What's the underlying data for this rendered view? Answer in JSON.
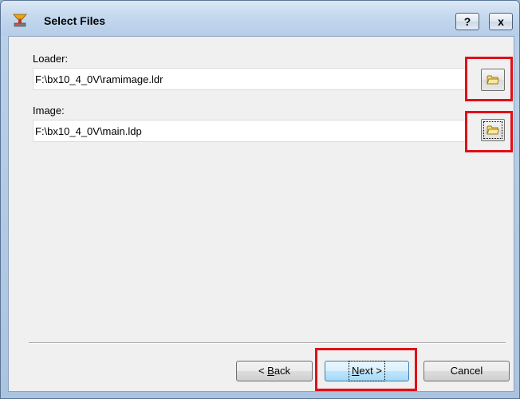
{
  "window": {
    "title": "Select Files",
    "help_label": "?",
    "close_label": "x"
  },
  "form": {
    "loader_label": "Loader:",
    "loader_value": "F:\\bx10_4_0V\\ramimage.ldr",
    "image_label": "Image:",
    "image_value": "F:\\bx10_4_0V\\main.ldp"
  },
  "buttons": {
    "back": {
      "prefix": "< ",
      "accel": "B",
      "rest": "ack"
    },
    "next": {
      "accel": "N",
      "rest": "ext >"
    },
    "cancel": "Cancel"
  },
  "icons": {
    "app": "computer-recovery-icon",
    "browse": "folder-icon"
  },
  "colors": {
    "highlight": "#e01018",
    "client_bg": "#f0f0f0"
  }
}
